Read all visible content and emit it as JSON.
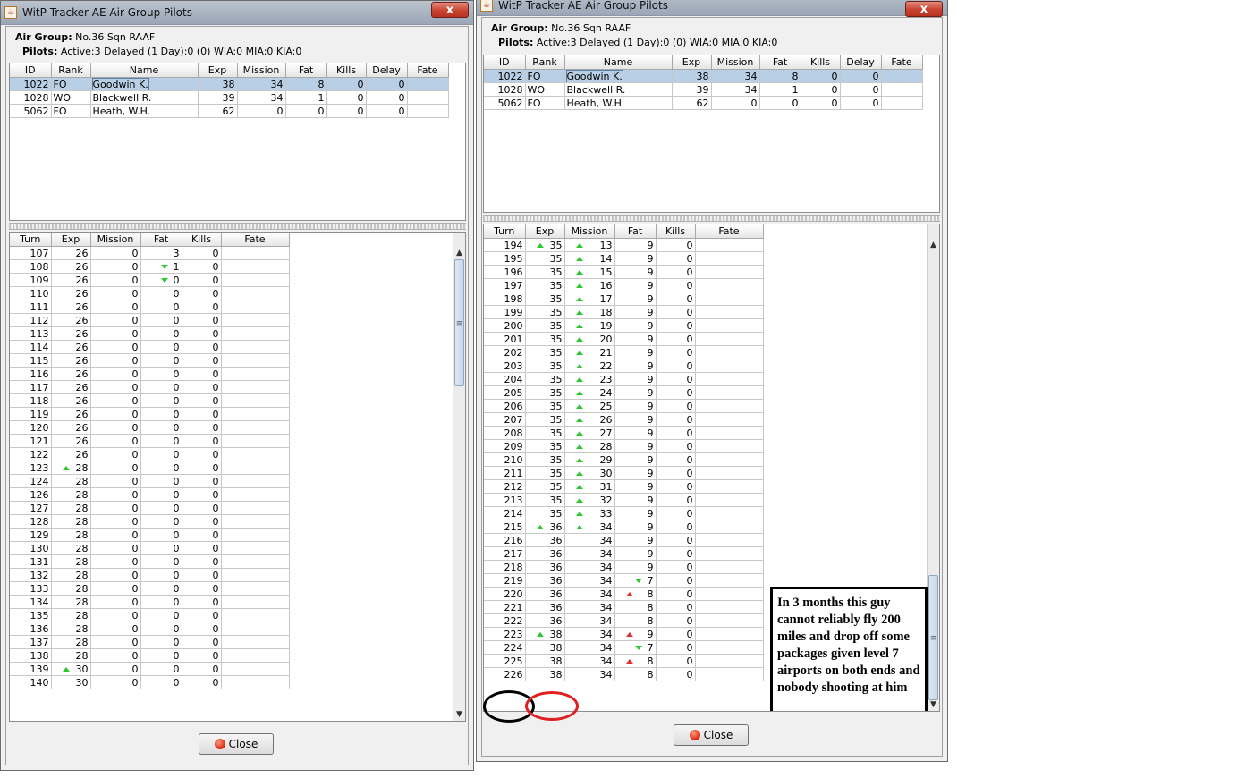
{
  "left_window": {
    "title": "WitP Tracker AE Air Group Pilots",
    "close_glyph": "x",
    "air_group_label": "Air Group:",
    "air_group_value": "No.36 Sqn RAAF",
    "pilots_label": "Pilots:",
    "pilots_value": "Active:3   Delayed (1 Day):0 (0)  WIA:0  MIA:0  KIA:0",
    "pilot_columns": [
      "ID",
      "Rank",
      "Name",
      "Exp",
      "Mission",
      "Fat",
      "Kills",
      "Delay",
      "Fate"
    ],
    "pilots": [
      {
        "id": "1022",
        "rank": "FO",
        "name": "Goodwin K.",
        "exp": "38",
        "mission": "34",
        "fat": "8",
        "kills": "0",
        "delay": "0",
        "fate": ""
      },
      {
        "id": "1028",
        "rank": "WO",
        "name": "Blackwell R.",
        "exp": "39",
        "mission": "34",
        "fat": "1",
        "kills": "0",
        "delay": "0",
        "fate": ""
      },
      {
        "id": "5062",
        "rank": "FO",
        "name": "Heath, W.H.",
        "exp": "62",
        "mission": "0",
        "fat": "0",
        "kills": "0",
        "delay": "0",
        "fate": ""
      }
    ],
    "history_columns": [
      "Turn",
      "Exp",
      "Mission",
      "Fat",
      "Kills",
      "Fate"
    ],
    "history": [
      {
        "turn": "107",
        "exp": "26",
        "mission": "0",
        "fat": "3",
        "kills": "0",
        "fate": ""
      },
      {
        "turn": "108",
        "exp": "26",
        "mission": "0",
        "fat": "1",
        "fat_mark": "down",
        "kills": "0",
        "fate": ""
      },
      {
        "turn": "109",
        "exp": "26",
        "mission": "0",
        "fat": "0",
        "fat_mark": "down",
        "kills": "0",
        "fate": ""
      },
      {
        "turn": "110",
        "exp": "26",
        "mission": "0",
        "fat": "0",
        "kills": "0",
        "fate": ""
      },
      {
        "turn": "111",
        "exp": "26",
        "mission": "0",
        "fat": "0",
        "kills": "0",
        "fate": ""
      },
      {
        "turn": "112",
        "exp": "26",
        "mission": "0",
        "fat": "0",
        "kills": "0",
        "fate": ""
      },
      {
        "turn": "113",
        "exp": "26",
        "mission": "0",
        "fat": "0",
        "kills": "0",
        "fate": ""
      },
      {
        "turn": "114",
        "exp": "26",
        "mission": "0",
        "fat": "0",
        "kills": "0",
        "fate": ""
      },
      {
        "turn": "115",
        "exp": "26",
        "mission": "0",
        "fat": "0",
        "kills": "0",
        "fate": ""
      },
      {
        "turn": "116",
        "exp": "26",
        "mission": "0",
        "fat": "0",
        "kills": "0",
        "fate": ""
      },
      {
        "turn": "117",
        "exp": "26",
        "mission": "0",
        "fat": "0",
        "kills": "0",
        "fate": ""
      },
      {
        "turn": "118",
        "exp": "26",
        "mission": "0",
        "fat": "0",
        "kills": "0",
        "fate": ""
      },
      {
        "turn": "119",
        "exp": "26",
        "mission": "0",
        "fat": "0",
        "kills": "0",
        "fate": ""
      },
      {
        "turn": "120",
        "exp": "26",
        "mission": "0",
        "fat": "0",
        "kills": "0",
        "fate": ""
      },
      {
        "turn": "121",
        "exp": "26",
        "mission": "0",
        "fat": "0",
        "kills": "0",
        "fate": ""
      },
      {
        "turn": "122",
        "exp": "26",
        "mission": "0",
        "fat": "0",
        "kills": "0",
        "fate": ""
      },
      {
        "turn": "123",
        "exp": "28",
        "exp_mark": "up",
        "mission": "0",
        "fat": "0",
        "kills": "0",
        "fate": ""
      },
      {
        "turn": "124",
        "exp": "28",
        "mission": "0",
        "fat": "0",
        "kills": "0",
        "fate": ""
      },
      {
        "turn": "126",
        "exp": "28",
        "mission": "0",
        "fat": "0",
        "kills": "0",
        "fate": ""
      },
      {
        "turn": "127",
        "exp": "28",
        "mission": "0",
        "fat": "0",
        "kills": "0",
        "fate": ""
      },
      {
        "turn": "128",
        "exp": "28",
        "mission": "0",
        "fat": "0",
        "kills": "0",
        "fate": ""
      },
      {
        "turn": "129",
        "exp": "28",
        "mission": "0",
        "fat": "0",
        "kills": "0",
        "fate": ""
      },
      {
        "turn": "130",
        "exp": "28",
        "mission": "0",
        "fat": "0",
        "kills": "0",
        "fate": ""
      },
      {
        "turn": "131",
        "exp": "28",
        "mission": "0",
        "fat": "0",
        "kills": "0",
        "fate": ""
      },
      {
        "turn": "132",
        "exp": "28",
        "mission": "0",
        "fat": "0",
        "kills": "0",
        "fate": ""
      },
      {
        "turn": "133",
        "exp": "28",
        "mission": "0",
        "fat": "0",
        "kills": "0",
        "fate": ""
      },
      {
        "turn": "134",
        "exp": "28",
        "mission": "0",
        "fat": "0",
        "kills": "0",
        "fate": ""
      },
      {
        "turn": "135",
        "exp": "28",
        "mission": "0",
        "fat": "0",
        "kills": "0",
        "fate": ""
      },
      {
        "turn": "136",
        "exp": "28",
        "mission": "0",
        "fat": "0",
        "kills": "0",
        "fate": ""
      },
      {
        "turn": "137",
        "exp": "28",
        "mission": "0",
        "fat": "0",
        "kills": "0",
        "fate": ""
      },
      {
        "turn": "138",
        "exp": "28",
        "mission": "0",
        "fat": "0",
        "kills": "0",
        "fate": ""
      },
      {
        "turn": "139",
        "exp": "30",
        "exp_mark": "up",
        "mission": "0",
        "fat": "0",
        "kills": "0",
        "fate": ""
      },
      {
        "turn": "140",
        "exp": "30",
        "mission": "0",
        "fat": "0",
        "kills": "0",
        "fate": ""
      }
    ],
    "close_button": "Close"
  },
  "right_window": {
    "title": "WitP Tracker AE Air Group Pilots",
    "close_glyph": "x",
    "air_group_label": "Air Group:",
    "air_group_value": "No.36 Sqn RAAF",
    "pilots_label": "Pilots:",
    "pilots_value": "Active:3   Delayed (1 Day):0 (0)  WIA:0  MIA:0  KIA:0",
    "pilot_columns": [
      "ID",
      "Rank",
      "Name",
      "Exp",
      "Mission",
      "Fat",
      "Kills",
      "Delay",
      "Fate"
    ],
    "pilots": [
      {
        "id": "1022",
        "rank": "FO",
        "name": "Goodwin K.",
        "exp": "38",
        "mission": "34",
        "fat": "8",
        "kills": "0",
        "delay": "0",
        "fate": ""
      },
      {
        "id": "1028",
        "rank": "WO",
        "name": "Blackwell R.",
        "exp": "39",
        "mission": "34",
        "fat": "1",
        "kills": "0",
        "delay": "0",
        "fate": ""
      },
      {
        "id": "5062",
        "rank": "FO",
        "name": "Heath, W.H.",
        "exp": "62",
        "mission": "0",
        "fat": "0",
        "kills": "0",
        "delay": "0",
        "fate": ""
      }
    ],
    "history_columns": [
      "Turn",
      "Exp",
      "Mission",
      "Fat",
      "Kills",
      "Fate"
    ],
    "history": [
      {
        "turn": "194",
        "exp": "35",
        "exp_mark": "up",
        "mission": "13",
        "mission_mark": "up",
        "fat": "9",
        "kills": "0",
        "fate": ""
      },
      {
        "turn": "195",
        "exp": "35",
        "mission": "14",
        "mission_mark": "up",
        "fat": "9",
        "kills": "0",
        "fate": ""
      },
      {
        "turn": "196",
        "exp": "35",
        "mission": "15",
        "mission_mark": "up",
        "fat": "9",
        "kills": "0",
        "fate": ""
      },
      {
        "turn": "197",
        "exp": "35",
        "mission": "16",
        "mission_mark": "up",
        "fat": "9",
        "kills": "0",
        "fate": ""
      },
      {
        "turn": "198",
        "exp": "35",
        "mission": "17",
        "mission_mark": "up",
        "fat": "9",
        "kills": "0",
        "fate": ""
      },
      {
        "turn": "199",
        "exp": "35",
        "mission": "18",
        "mission_mark": "up",
        "fat": "9",
        "kills": "0",
        "fate": ""
      },
      {
        "turn": "200",
        "exp": "35",
        "mission": "19",
        "mission_mark": "up",
        "fat": "9",
        "kills": "0",
        "fate": ""
      },
      {
        "turn": "201",
        "exp": "35",
        "mission": "20",
        "mission_mark": "up",
        "fat": "9",
        "kills": "0",
        "fate": ""
      },
      {
        "turn": "202",
        "exp": "35",
        "mission": "21",
        "mission_mark": "up",
        "fat": "9",
        "kills": "0",
        "fate": ""
      },
      {
        "turn": "203",
        "exp": "35",
        "mission": "22",
        "mission_mark": "up",
        "fat": "9",
        "kills": "0",
        "fate": ""
      },
      {
        "turn": "204",
        "exp": "35",
        "mission": "23",
        "mission_mark": "up",
        "fat": "9",
        "kills": "0",
        "fate": ""
      },
      {
        "turn": "205",
        "exp": "35",
        "mission": "24",
        "mission_mark": "up",
        "fat": "9",
        "kills": "0",
        "fate": ""
      },
      {
        "turn": "206",
        "exp": "35",
        "mission": "25",
        "mission_mark": "up",
        "fat": "9",
        "kills": "0",
        "fate": ""
      },
      {
        "turn": "207",
        "exp": "35",
        "mission": "26",
        "mission_mark": "up",
        "fat": "9",
        "kills": "0",
        "fate": ""
      },
      {
        "turn": "208",
        "exp": "35",
        "mission": "27",
        "mission_mark": "up",
        "fat": "9",
        "kills": "0",
        "fate": ""
      },
      {
        "turn": "209",
        "exp": "35",
        "mission": "28",
        "mission_mark": "up",
        "fat": "9",
        "kills": "0",
        "fate": ""
      },
      {
        "turn": "210",
        "exp": "35",
        "mission": "29",
        "mission_mark": "up",
        "fat": "9",
        "kills": "0",
        "fate": ""
      },
      {
        "turn": "211",
        "exp": "35",
        "mission": "30",
        "mission_mark": "up",
        "fat": "9",
        "kills": "0",
        "fate": ""
      },
      {
        "turn": "212",
        "exp": "35",
        "mission": "31",
        "mission_mark": "up",
        "fat": "9",
        "kills": "0",
        "fate": ""
      },
      {
        "turn": "213",
        "exp": "35",
        "mission": "32",
        "mission_mark": "up",
        "fat": "9",
        "kills": "0",
        "fate": ""
      },
      {
        "turn": "214",
        "exp": "35",
        "mission": "33",
        "mission_mark": "up",
        "fat": "9",
        "kills": "0",
        "fate": ""
      },
      {
        "turn": "215",
        "exp": "36",
        "exp_mark": "up",
        "mission": "34",
        "mission_mark": "up",
        "fat": "9",
        "kills": "0",
        "fate": ""
      },
      {
        "turn": "216",
        "exp": "36",
        "mission": "34",
        "fat": "9",
        "kills": "0",
        "fate": ""
      },
      {
        "turn": "217",
        "exp": "36",
        "mission": "34",
        "fat": "9",
        "kills": "0",
        "fate": ""
      },
      {
        "turn": "218",
        "exp": "36",
        "mission": "34",
        "fat": "9",
        "kills": "0",
        "fate": ""
      },
      {
        "turn": "219",
        "exp": "36",
        "mission": "34",
        "fat": "7",
        "fat_mark": "down",
        "kills": "0",
        "fate": ""
      },
      {
        "turn": "220",
        "exp": "36",
        "mission": "34",
        "fat": "8",
        "fat_mark": "up-red",
        "kills": "0",
        "fate": ""
      },
      {
        "turn": "221",
        "exp": "36",
        "mission": "34",
        "fat": "8",
        "kills": "0",
        "fate": ""
      },
      {
        "turn": "222",
        "exp": "36",
        "mission": "34",
        "fat": "8",
        "kills": "0",
        "fate": ""
      },
      {
        "turn": "223",
        "exp": "38",
        "exp_mark": "up",
        "mission": "34",
        "fat": "9",
        "fat_mark": "up-red",
        "kills": "0",
        "fate": ""
      },
      {
        "turn": "224",
        "exp": "38",
        "mission": "34",
        "fat": "7",
        "fat_mark": "down",
        "kills": "0",
        "fate": ""
      },
      {
        "turn": "225",
        "exp": "38",
        "mission": "34",
        "fat": "8",
        "fat_mark": "up-red",
        "kills": "0",
        "fate": ""
      },
      {
        "turn": "226",
        "exp": "38",
        "mission": "34",
        "fat": "8",
        "kills": "0",
        "fate": ""
      }
    ],
    "close_button": "Close",
    "annotation": "In 3 months this guy cannot reliably fly 200 miles and drop off some packages given level 7 airports on both ends and nobody shooting at him"
  }
}
